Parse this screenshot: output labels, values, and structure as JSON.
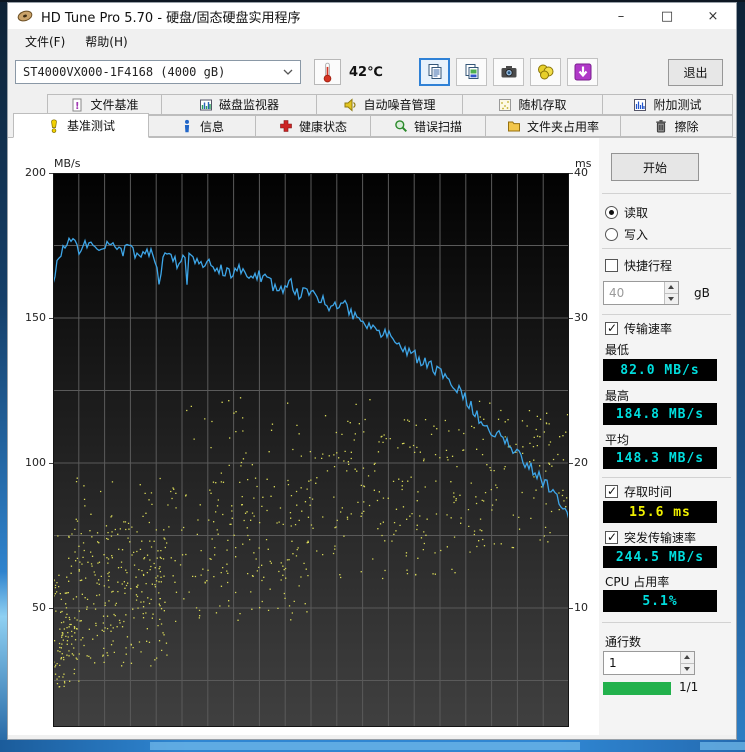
{
  "window": {
    "title": "HD Tune Pro 5.70 - 硬盘/固态硬盘实用程序",
    "minimize_glyph": "–",
    "maximize_glyph": "□",
    "close_glyph": "×"
  },
  "menu": {
    "file": "文件(F)",
    "help": "帮助(H)"
  },
  "toolbar": {
    "drive": "ST4000VX000-1F4168 (4000 gB)",
    "temperature": "42℃",
    "exit_label": "退出",
    "icons": [
      "thermometer-icon",
      "copy-text-icon",
      "copy-image-icon",
      "camera-icon",
      "coins-icon",
      "download-icon"
    ]
  },
  "tabs": {
    "row1": [
      {
        "label": "文件基准",
        "icon": "file-benchmark-icon"
      },
      {
        "label": "磁盘监视器",
        "icon": "disk-monitor-icon"
      },
      {
        "label": "自动噪音管理",
        "icon": "aam-icon"
      },
      {
        "label": "随机存取",
        "icon": "random-access-icon"
      },
      {
        "label": "附加测试",
        "icon": "extra-tests-icon"
      }
    ],
    "row2": [
      {
        "label": "基准测试",
        "icon": "benchmark-icon",
        "active": true
      },
      {
        "label": "信息",
        "icon": "info-icon"
      },
      {
        "label": "健康状态",
        "icon": "health-icon"
      },
      {
        "label": "错误扫描",
        "icon": "error-scan-icon"
      },
      {
        "label": "文件夹占用率",
        "icon": "folder-usage-icon"
      },
      {
        "label": "擦除",
        "icon": "erase-icon"
      }
    ],
    "active_tab": "基准测试"
  },
  "panel": {
    "start_label": "开始",
    "read_label": "读取",
    "write_label": "写入",
    "read_selected": true,
    "write_selected": false,
    "short_stroke_label": "快捷行程",
    "short_stroke_checked": false,
    "short_stroke_value": "40",
    "short_stroke_unit": "gB",
    "transfer_label": "传输速率",
    "transfer_checked": true,
    "min_label": "最低",
    "min_value": "82.0 MB/s",
    "max_label": "最高",
    "max_value": "184.8 MB/s",
    "avg_label": "平均",
    "avg_value": "148.3 MB/s",
    "access_label": "存取时间",
    "access_checked": true,
    "access_value": "15.6 ms",
    "burst_label": "突发传输速率",
    "burst_checked": true,
    "burst_value": "244.5 MB/s",
    "cpu_label": "CPU 占用率",
    "cpu_value": "5.1%",
    "passes_label": "通行数",
    "passes_value": "1",
    "progress_label": "1/1",
    "progress_percent": 100
  },
  "chart_data": {
    "type": "line+scatter",
    "x_grid_divisions": 20,
    "y_left": {
      "label": "MB/s",
      "ticks": [
        200,
        150,
        100,
        50
      ],
      "top_value": 200,
      "units_per_grid": 25
    },
    "y_right": {
      "label": "ms",
      "ticks": [
        40,
        30,
        20,
        10
      ],
      "top_value": 40,
      "units_per_grid": 5
    },
    "plot": {
      "bg_top": "#020202",
      "bg_bottom": "#404040",
      "grid_color": "#5a5a5a"
    },
    "stats": {
      "min_mbs": 82.0,
      "max_mbs": 184.8,
      "avg_mbs": 148.3,
      "access_ms": 15.6,
      "burst_mbs": 244.5,
      "cpu_pct": 5.1
    },
    "series": [
      {
        "name": "transfer-rate",
        "unit": "MB/s",
        "color": "#3ea6e8",
        "noise": 4.5,
        "seed": 9,
        "anchors": [
          [
            0,
            163
          ],
          [
            0.012,
            172
          ],
          [
            0.03,
            177
          ],
          [
            0.05,
            174
          ],
          [
            0.07,
            176
          ],
          [
            0.09,
            173
          ],
          [
            0.11,
            175
          ],
          [
            0.13,
            172
          ],
          [
            0.15,
            174
          ],
          [
            0.17,
            171
          ],
          [
            0.19,
            173
          ],
          [
            0.2,
            172
          ],
          [
            0.205,
            163
          ],
          [
            0.215,
            171
          ],
          [
            0.24,
            169
          ],
          [
            0.26,
            171
          ],
          [
            0.28,
            169
          ],
          [
            0.3,
            170
          ],
          [
            0.32,
            167
          ],
          [
            0.34,
            165
          ],
          [
            0.36,
            167
          ],
          [
            0.38,
            163
          ],
          [
            0.4,
            165
          ],
          [
            0.42,
            162
          ],
          [
            0.44,
            160
          ],
          [
            0.46,
            162
          ],
          [
            0.48,
            158
          ],
          [
            0.5,
            159
          ],
          [
            0.52,
            156
          ],
          [
            0.54,
            154
          ],
          [
            0.56,
            155
          ],
          [
            0.58,
            151
          ],
          [
            0.6,
            149
          ],
          [
            0.62,
            147
          ],
          [
            0.64,
            145
          ],
          [
            0.66,
            142
          ],
          [
            0.68,
            140
          ],
          [
            0.7,
            137
          ],
          [
            0.72,
            135
          ],
          [
            0.74,
            132
          ],
          [
            0.76,
            129
          ],
          [
            0.78,
            126
          ],
          [
            0.8,
            122
          ],
          [
            0.82,
            117
          ],
          [
            0.84,
            113
          ],
          [
            0.86,
            110
          ],
          [
            0.88,
            107
          ],
          [
            0.9,
            103
          ],
          [
            0.92,
            99
          ],
          [
            0.94,
            96
          ],
          [
            0.96,
            92
          ],
          [
            0.98,
            87
          ],
          [
            1,
            82
          ]
        ]
      },
      {
        "name": "access-time",
        "unit": "ms",
        "color": "#d8d858",
        "seed": 77,
        "regions": [
          [
            0.0,
            0.05,
            4.5,
            12.5,
            70
          ],
          [
            0.0,
            0.22,
            6.0,
            15.5,
            230
          ],
          [
            0.04,
            0.5,
            9.0,
            19.0,
            210
          ],
          [
            0.3,
            0.85,
            12.0,
            21.0,
            170
          ],
          [
            0.55,
            1.0,
            14.0,
            23.0,
            110
          ],
          [
            0.25,
            0.95,
            20.5,
            24.5,
            50
          ],
          [
            0.85,
            1.0,
            16.0,
            24.0,
            35
          ]
        ]
      }
    ]
  }
}
